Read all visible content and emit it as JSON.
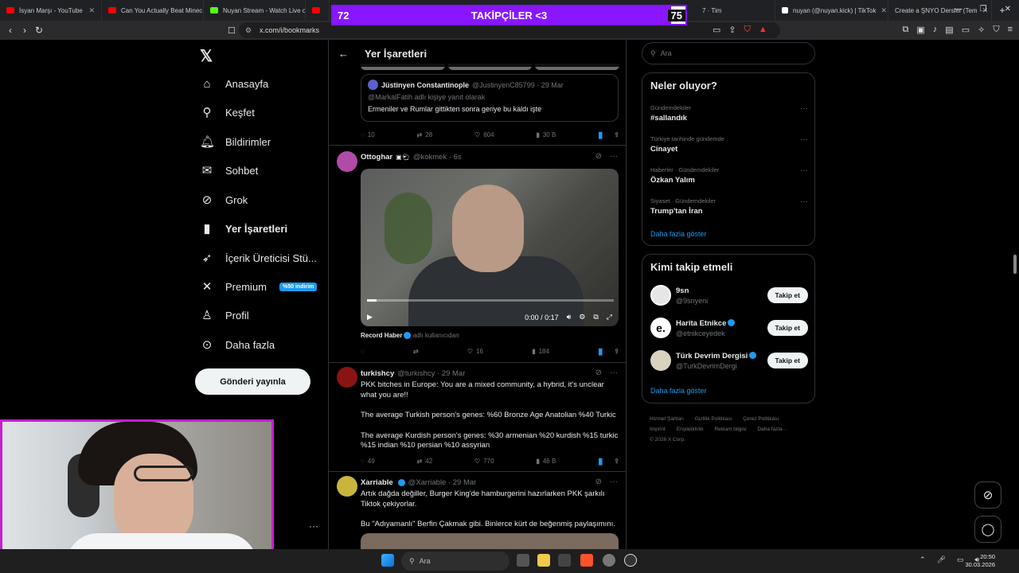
{
  "browser": {
    "tabs": [
      {
        "label": "İsyan Marşı - YouTube",
        "color": "#ff0000"
      },
      {
        "label": "Can You Actually Beat Minec",
        "color": "#ff0000"
      },
      {
        "label": "Nuyan Stream - Watch Live o",
        "color": "#53fc18"
      },
      {
        "label": "Yo",
        "color": "#ff0000"
      },
      {
        "label": "7 · Tim",
        "color": "#888888"
      },
      {
        "label": "nuyan (@nuyan.kick) | TikTok",
        "color": "#ffffff"
      },
      {
        "label": "Create a ŞNYO Dersler (Tem",
        "color": "#888888"
      }
    ],
    "url": "x.com/i/bookmarks"
  },
  "overlay": {
    "title": "TAKİPÇİLER <3",
    "current": "72",
    "goal": "75",
    "progress": 0.96
  },
  "leftnav": {
    "items": [
      {
        "label": "Anasayfa",
        "icon": "home-icon",
        "glyph": "⌂"
      },
      {
        "label": "Keşfet",
        "icon": "search-icon",
        "glyph": "⚲"
      },
      {
        "label": "Bildirimler",
        "icon": "bell-icon",
        "glyph": "♫"
      },
      {
        "label": "Sohbet",
        "icon": "mail-icon",
        "glyph": "✉"
      },
      {
        "label": "Grok",
        "icon": "grok-icon",
        "glyph": "⊘"
      },
      {
        "label": "Yer İşaretleri",
        "icon": "bookmark-icon",
        "glyph": "▮"
      },
      {
        "label": "İçerik Üreticisi Stü...",
        "icon": "rocket-icon",
        "glyph": "➶"
      },
      {
        "label": "Premium",
        "icon": "x-logo-icon",
        "glyph": "✕"
      },
      {
        "label": "Profil",
        "icon": "profile-icon",
        "glyph": "♙"
      },
      {
        "label": "Daha fazla",
        "icon": "more-circle-icon",
        "glyph": "⊙"
      }
    ],
    "premium_badge": "%50 indirim",
    "post_button": "Gönderi yayınla",
    "more": "···"
  },
  "center": {
    "header": "Yer İşaretleri",
    "quote": {
      "name": "Jüstinyen Constantinople",
      "handle": "@JustinyenC85799 · 29 Mar",
      "reply_to": "@MarkalFatih adlı kişiye yanıt olarak",
      "text": "Ermeniler ve Rumlar gittikten sonra geriye bu kaldı işte"
    },
    "actions1": {
      "replies": "10",
      "reposts": "28",
      "likes": "604",
      "views": "30 B"
    },
    "post1": {
      "name": "Ottoghar",
      "handle": "@kokmek · 6s",
      "video_time": "0:00 / 0:17",
      "video_progress": 0.04,
      "attribution_name": "Record Haber",
      "attribution_suffix": "adlı kullanıcıdan",
      "actions": {
        "replies": "",
        "reposts": "",
        "likes": "16",
        "views": "184"
      }
    },
    "post2": {
      "name": "turkishcy",
      "handle": "@turkishcy · 29 Mar",
      "text1": "PKK bitches in Europe: You are a mixed community, a hybrid, it's unclear what you are!!",
      "text2": "The average Turkish person's genes: %60 Bronze Age Anatolian %40 Turkic",
      "text3": "The average Kurdish person's genes: %30 armenian %20 kurdish %15 turkic %15 indian %10 persian %10 assyrian",
      "actions": {
        "replies": "49",
        "reposts": "42",
        "likes": "770",
        "views": "46 B"
      }
    },
    "post3": {
      "name": "Xarriable",
      "handle": "@Xarriable · 29 Mar",
      "text1": "Artık dağda değiller, Burger King'de hamburgerini hazırlarken PKK şarkılı Tiktok çekiyorlar.",
      "text2": "Bu \"Adıyamanlı\" Berfin Çakmak gibi. Binlerce kürt de beğenmiş paylaşımını."
    }
  },
  "right": {
    "search_placeholder": "Ara",
    "trends_title": "Neler oluyor?",
    "trends": [
      {
        "category": "Gündemdekiler",
        "name": "#sallandık"
      },
      {
        "category": "Türkiye tarihinde gündemde",
        "name": "Cinayet"
      },
      {
        "category": "Haberler · Gündemdekiler",
        "name": "Özkan Yalım"
      },
      {
        "category": "Siyaset · Gündemdekiler",
        "name": "Trump'tan İran"
      }
    ],
    "show_more": "Daha fazla göster",
    "who_title": "Kimi takip etmeli",
    "who": [
      {
        "name": "9sn",
        "handle": "@9snyeni",
        "verified": false
      },
      {
        "name": "Harita Etnikce",
        "handle": "@etnikceyedek",
        "verified": true
      },
      {
        "name": "Türk Devrim Dergisi",
        "handle": "@TurkDevrimDergi",
        "verified": true
      }
    ],
    "follow_label": "Takip et",
    "footer": [
      "Hizmet Şartları",
      "Gizlilik Politikası",
      "Çerez Politikası",
      "Imprint",
      "Erişilebilirlik",
      "Reklam bilgisi",
      "Daha fazla···",
      "© 2026 X Corp."
    ]
  },
  "taskbar": {
    "search": "Ara",
    "time": "20:50",
    "date": "30.03.2026"
  }
}
